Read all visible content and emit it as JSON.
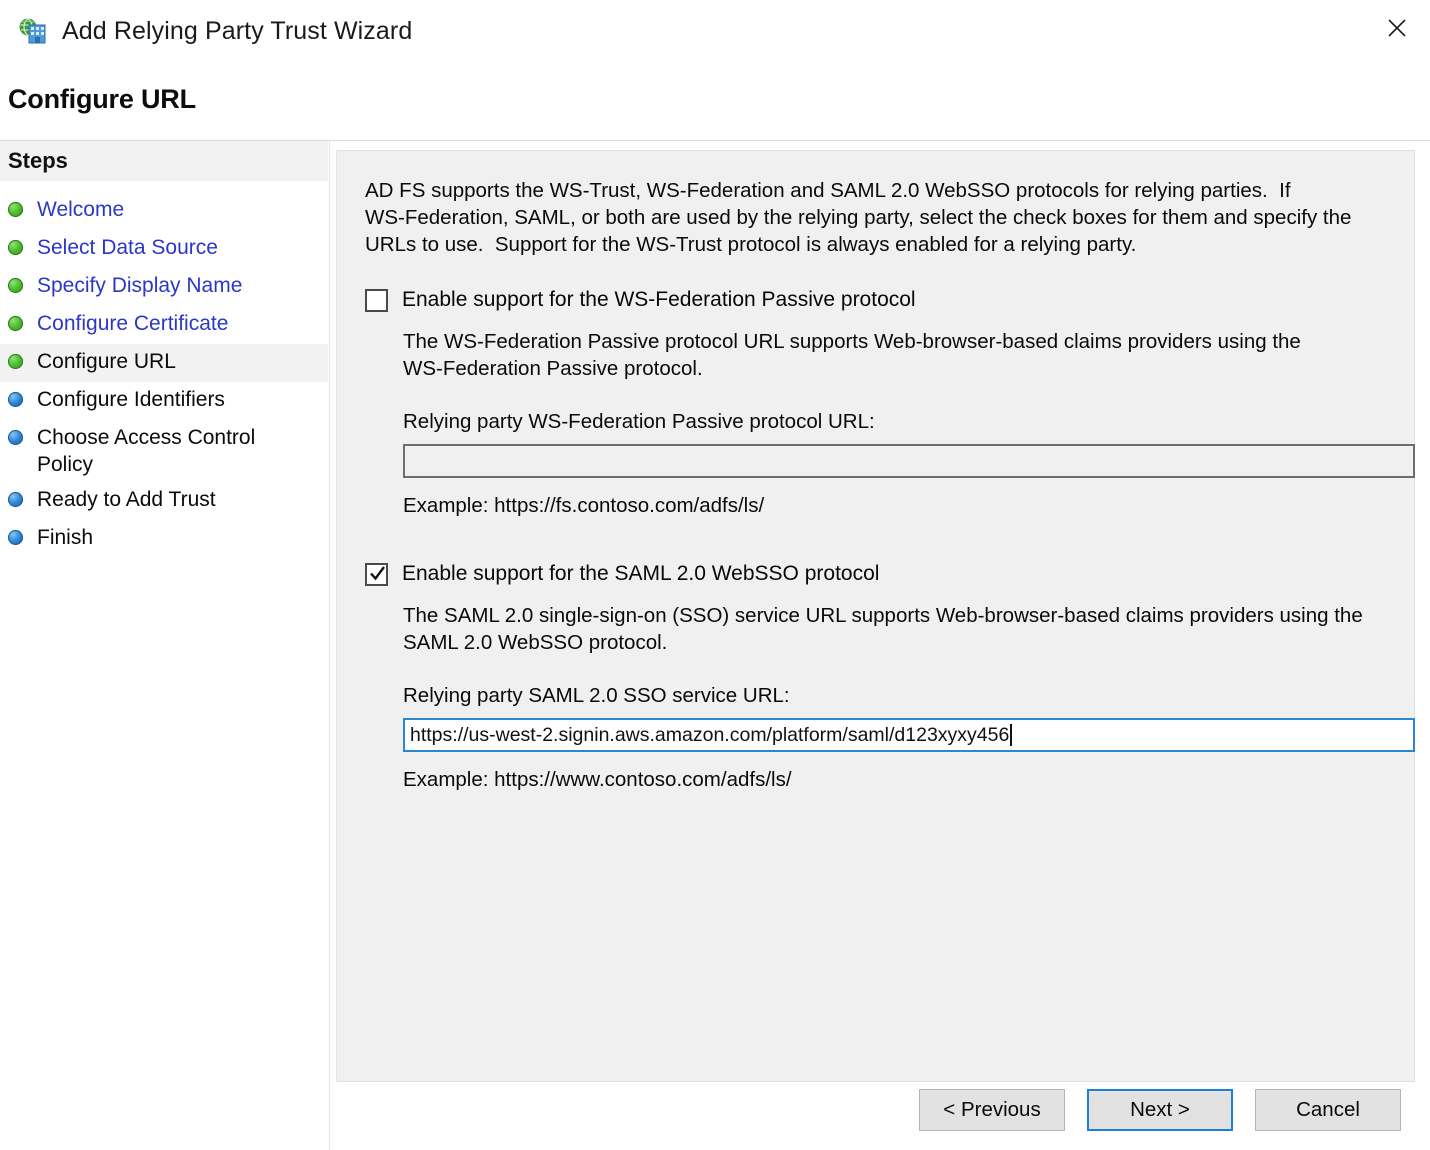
{
  "window": {
    "title": "Add Relying Party Trust Wizard",
    "icon": "adfs-globe-server-icon",
    "close_label": "✕"
  },
  "page": {
    "heading": "Configure URL"
  },
  "sidebar": {
    "header": "Steps",
    "items": [
      {
        "label": "Welcome",
        "state": "done",
        "current": false
      },
      {
        "label": "Select Data Source",
        "state": "done",
        "current": false
      },
      {
        "label": "Specify Display Name",
        "state": "done",
        "current": false
      },
      {
        "label": "Configure Certificate",
        "state": "done",
        "current": false
      },
      {
        "label": "Configure URL",
        "state": "done",
        "current": true
      },
      {
        "label": "Configure Identifiers",
        "state": "todo",
        "current": false
      },
      {
        "label": "Choose Access Control\nPolicy",
        "state": "todo",
        "current": false
      },
      {
        "label": "Ready to Add Trust",
        "state": "todo",
        "current": false
      },
      {
        "label": "Finish",
        "state": "todo",
        "current": false
      }
    ]
  },
  "main": {
    "intro": "AD FS supports the WS-Trust, WS-Federation and SAML 2.0 WebSSO protocols for relying parties.  If\nWS-Federation, SAML, or both are used by the relying party, select the check boxes for them and specify the\nURLs to use.  Support for the WS-Trust protocol is always enabled for a relying party.",
    "wsfed": {
      "checkbox_label": "Enable support for the WS-Federation Passive protocol",
      "checked": false,
      "description": "The WS-Federation Passive protocol URL supports Web-browser-based claims providers using the\nWS-Federation Passive protocol.",
      "field_label": "Relying party WS-Federation Passive protocol URL:",
      "value": "",
      "placeholder": "",
      "example": "Example: https://fs.contoso.com/adfs/ls/"
    },
    "saml": {
      "checkbox_label": "Enable support for the SAML 2.0 WebSSO protocol",
      "checked": true,
      "description": "The SAML 2.0 single-sign-on (SSO) service URL supports Web-browser-based claims providers using the\nSAML 2.0 WebSSO protocol.",
      "field_label": "Relying party SAML 2.0 SSO service URL:",
      "value": "https://us-west-2.signin.aws.amazon.com/platform/saml/d123xyxy456",
      "placeholder": "",
      "example": "Example: https://www.contoso.com/adfs/ls/"
    }
  },
  "footer": {
    "previous_label": "< Previous",
    "next_label": "Next >",
    "cancel_label": "Cancel"
  },
  "colors": {
    "panel_bg": "#f0f0f0",
    "link": "#2b37c8",
    "focus_border": "#2b87d3",
    "done_bullet": "#4cbb2e",
    "todo_bullet": "#2e86d4"
  }
}
